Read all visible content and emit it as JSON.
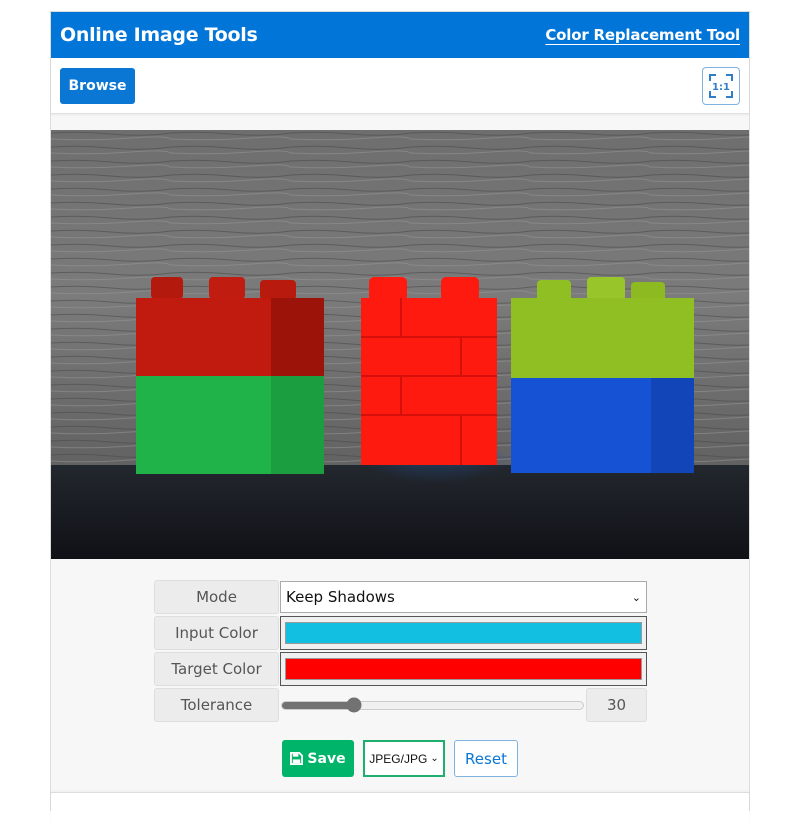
{
  "header": {
    "app_title": "Online Image Tools",
    "tool_name": "Color Replacement Tool"
  },
  "toolbar": {
    "browse_label": "Browse",
    "ratio_icon_text": "1:1"
  },
  "image": {
    "description": "Photo of toy building blocks on dark surface against grey wood wall",
    "blocks": [
      {
        "position": "left",
        "top_color": "#c41a0e",
        "bottom_color": "#1fb34a"
      },
      {
        "position": "center",
        "color": "#ff1a10"
      },
      {
        "position": "right",
        "top_color": "#8fbf22",
        "bottom_color": "#1552d4"
      }
    ]
  },
  "controls": {
    "mode": {
      "label": "Mode",
      "value": "Keep Shadows"
    },
    "input_color": {
      "label": "Input Color",
      "value": "#13bfe0"
    },
    "target_color": {
      "label": "Target Color",
      "value": "#ff0000"
    },
    "tolerance": {
      "label": "Tolerance",
      "value": "30",
      "fraction": 0.24
    }
  },
  "actions": {
    "save_label": "Save",
    "format_value": "JPEG/JPG",
    "reset_label": "Reset"
  },
  "colors": {
    "brand": "#0275d8",
    "save": "#00b46a"
  }
}
